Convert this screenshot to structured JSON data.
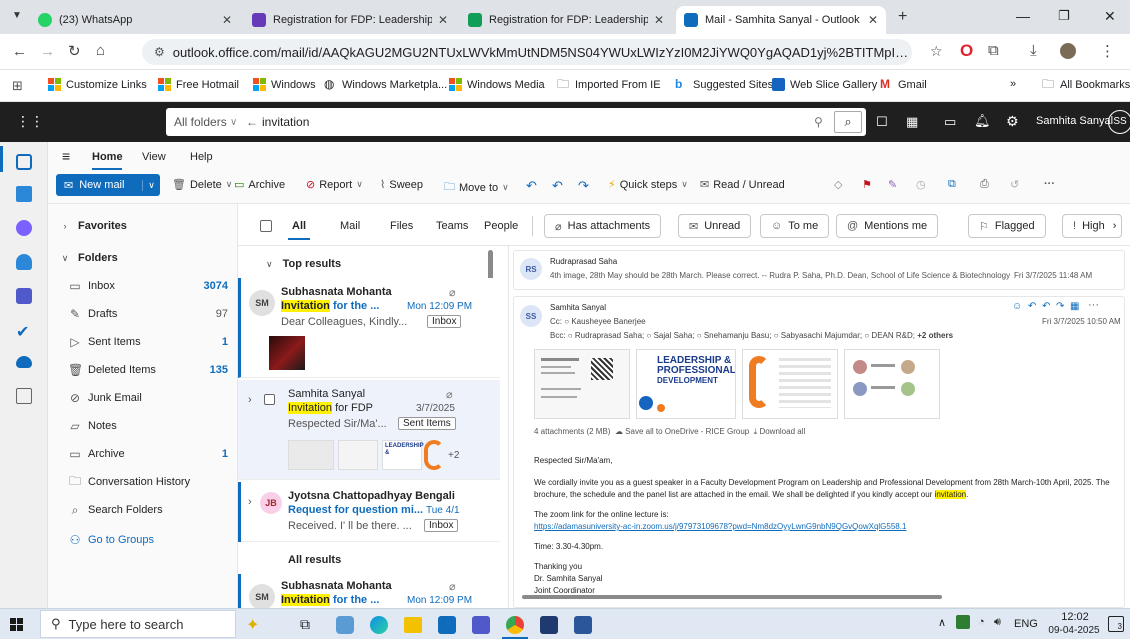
{
  "browser": {
    "tabs": [
      {
        "title": "(23) WhatsApp",
        "active": false
      },
      {
        "title": "Registration for FDP: Leadership",
        "active": false
      },
      {
        "title": "Registration for FDP: Leadership",
        "active": false
      },
      {
        "title": "Mail - Samhita Sanyal - Outlook",
        "active": true
      }
    ],
    "url": "outlook.office.com/mail/id/AAQkAGU2MGU2NTUxLWVkMmUtNDM5NS04YWUxLWIzYzI0M2JiYWQ0YgAQAD1yj%2BTITMpIuXVRmTnulvc...",
    "bookmarks": [
      "Customize Links",
      "Free Hotmail",
      "Windows",
      "Windows Marketpla...",
      "Windows Media",
      "Imported From IE",
      "Suggested Sites",
      "Web Slice Gallery",
      "Gmail"
    ],
    "all_bookmarks": "All Bookmarks",
    "overflow": "»"
  },
  "outlook": {
    "scope": "All folders",
    "search_text": "invitation",
    "user_name": "Samhita Sanyal",
    "user_initials": "SS",
    "ribbon_tabs": [
      "Home",
      "View",
      "Help"
    ],
    "actions": {
      "new_mail": "New mail",
      "delete": "Delete",
      "archive": "Archive",
      "report": "Report",
      "sweep": "Sweep",
      "move_to": "Move to",
      "quick_steps": "Quick steps",
      "read_unread": "Read / Unread"
    },
    "filters": {
      "all": "All",
      "mail": "Mail",
      "files": "Files",
      "teams": "Teams",
      "people": "People",
      "has_attachments": "Has attachments",
      "unread": "Unread",
      "to_me": "To me",
      "mentions_me": "Mentions me",
      "flagged": "Flagged",
      "high": "High"
    },
    "folders": {
      "favorites": "Favorites",
      "folders_label": "Folders",
      "items": [
        {
          "name": "Inbox",
          "count": "3074"
        },
        {
          "name": "Drafts",
          "count": "97"
        },
        {
          "name": "Sent Items",
          "count": "1"
        },
        {
          "name": "Deleted Items",
          "count": "135"
        },
        {
          "name": "Junk Email",
          "count": ""
        },
        {
          "name": "Notes",
          "count": ""
        },
        {
          "name": "Archive",
          "count": "1"
        },
        {
          "name": "Conversation History",
          "count": ""
        },
        {
          "name": "Search Folders",
          "count": ""
        }
      ],
      "go_to_groups": "Go to Groups"
    },
    "list": {
      "top_results": "Top results",
      "all_results": "All results",
      "messages": [
        {
          "initials": "SM",
          "sender": "Subhasnata Mohanta",
          "subject_hl": "Invitation",
          "subject_rest": " for the ...",
          "time": "Mon 12:09 PM",
          "preview": "Dear Colleagues, Kindly...",
          "tag": "Inbox"
        },
        {
          "initials": "",
          "sender": "Samhita Sanyal",
          "subject_hl": "Invitation",
          "subject_rest": " for FDP",
          "time": "3/7/2025",
          "preview": "Respected Sir/Ma'...",
          "tag": "Sent Items",
          "extra": "+2"
        },
        {
          "initials": "JB",
          "sender": "Jyotsna Chattopadhyay Bengali",
          "subject_hl": "",
          "subject_rest": "Request for question mi...",
          "time": "Tue 4/1",
          "preview": "Received. I' ll be there. ...",
          "tag": "Inbox"
        },
        {
          "initials": "SM",
          "sender": "Subhasnata Mohanta",
          "subject_hl": "Invitation",
          "subject_rest": " for the ...",
          "time": "Mon 12:09 PM",
          "preview": "",
          "tag": ""
        }
      ]
    },
    "reading": {
      "email1": {
        "initials": "RS",
        "sender": "Rudraprasad Saha",
        "preview": "4th image, 28th May should be 28th March. Please correct. -- Rudra P. Saha, Ph.D. Dean, School of Life Science & Biotechnology Pr...",
        "date": "Fri 3/7/2025 11:48 AM"
      },
      "email2": {
        "initials": "SS",
        "sender": "Samhita Sanyal",
        "cc_label": "Cc:",
        "cc": "Kausheyee Banerjee",
        "bcc_label": "Bcc:",
        "bcc": [
          "Rudraprasad Saha;",
          "Sajal Saha;",
          "Snehamanju Basu;",
          "Sabyasachi Majumdar;",
          "DEAN R&D;"
        ],
        "bcc_more": "+2 others",
        "date": "Fri 3/7/2025 10:50 AM",
        "poster_title_1": "LEADERSHIP &",
        "poster_title_2": "PROFESSIONAL",
        "poster_title_3": "DEVELOPMENT",
        "attachments": "4 attachments (2 MB)",
        "save_all": "Save all to OneDrive - RICE Group",
        "download_all": "Download all",
        "salutation": "Respected Sir/Ma'am,",
        "body1": "We cordially invite you as a guest speaker in a Faculty Development Program on Leadership and Professional Development from 28th March-10th April, 2025. The brochure, the schedule and the panel list are attached in the email. We shall be delighted if you kindly accept our ",
        "body1_hl": "invitation",
        "body1_end": ".",
        "zoom_text": "The zoom link for the online lecture is:",
        "zoom_link": "https://adamasuniversity-ac-in.zoom.us/j/97973109678?pwd=Nm8dzOyyLwnG9nbN9QGvQowXqlG558.1",
        "time": "Time: 3.30-4.30pm.",
        "thanks": "Thanking you",
        "sig1": "Dr. Samhita Sanyal",
        "sig2": "Joint Coordinator"
      }
    }
  },
  "taskbar": {
    "search_placeholder": "Type here to search",
    "lang": "ENG",
    "time": "12:02",
    "date": "09-04-2025",
    "notif_count": "3"
  },
  "colors": {
    "accent": "#0f6cbd",
    "highlight": "#fff100",
    "outlook_header": "#1f1f1f"
  }
}
